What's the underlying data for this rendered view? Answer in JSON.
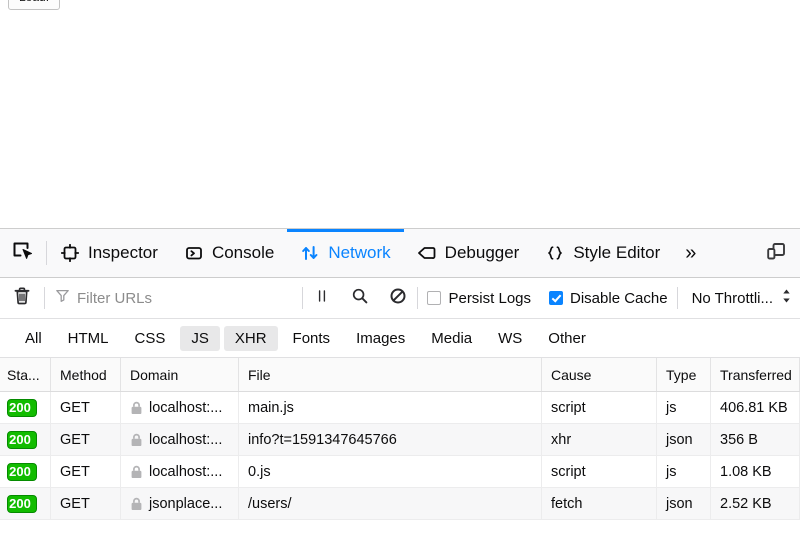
{
  "page": {
    "load_button_label": "Load!"
  },
  "toolbox": {
    "picker_icon": "element-picker-icon",
    "tabs": [
      {
        "label": "Inspector",
        "icon": "inspector-icon",
        "selected": false
      },
      {
        "label": "Console",
        "icon": "console-icon",
        "selected": false
      },
      {
        "label": "Network",
        "icon": "network-arrows-icon",
        "selected": true
      },
      {
        "label": "Debugger",
        "icon": "debugger-tag-icon",
        "selected": false
      },
      {
        "label": "Style Editor",
        "icon": "style-editor-braces-icon",
        "selected": false
      }
    ],
    "overflow_label": "»",
    "responsive_mode_icon": "responsive-design-mode-icon"
  },
  "network_toolbar": {
    "clear_icon": "trash-icon",
    "filter_placeholder": "Filter URLs",
    "filter_value": "",
    "pause_icon": "pause-icon",
    "search_icon": "search-icon",
    "block_icon": "block-icon",
    "persist_logs": {
      "label": "Persist Logs",
      "checked": false
    },
    "disable_cache": {
      "label": "Disable Cache",
      "checked": true
    },
    "throttling": {
      "label": "No Throttli...",
      "icon": "updown-arrows-icon"
    }
  },
  "type_filters": [
    {
      "label": "All",
      "active": false
    },
    {
      "label": "HTML",
      "active": false
    },
    {
      "label": "CSS",
      "active": false
    },
    {
      "label": "JS",
      "active": true
    },
    {
      "label": "XHR",
      "active": true
    },
    {
      "label": "Fonts",
      "active": false
    },
    {
      "label": "Images",
      "active": false
    },
    {
      "label": "Media",
      "active": false
    },
    {
      "label": "WS",
      "active": false
    },
    {
      "label": "Other",
      "active": false
    }
  ],
  "table": {
    "columns": [
      "Sta...",
      "Method",
      "Domain",
      "File",
      "Cause",
      "Type",
      "Transferred"
    ],
    "rows": [
      {
        "status": "200",
        "method": "GET",
        "domain": "localhost:...",
        "file": "main.js",
        "cause": "script",
        "type": "js",
        "transferred": "406.81 KB",
        "secure": true
      },
      {
        "status": "200",
        "method": "GET",
        "domain": "localhost:...",
        "file": "info?t=1591347645766",
        "cause": "xhr",
        "type": "json",
        "transferred": "356 B",
        "secure": true
      },
      {
        "status": "200",
        "method": "GET",
        "domain": "localhost:...",
        "file": "0.js",
        "cause": "script",
        "type": "js",
        "transferred": "1.08 KB",
        "secure": true
      },
      {
        "status": "200",
        "method": "GET",
        "domain": "jsonplace...",
        "file": "/users/",
        "cause": "fetch",
        "type": "json",
        "transferred": "2.52 KB",
        "secure": true
      }
    ]
  },
  "colors": {
    "accent": "#0a84ff",
    "status_ok_bg": "#12bc00",
    "status_ok_border": "#058b00",
    "toolbar_bg": "#f9f9fa",
    "row_alt_bg": "#f7f7f8"
  }
}
